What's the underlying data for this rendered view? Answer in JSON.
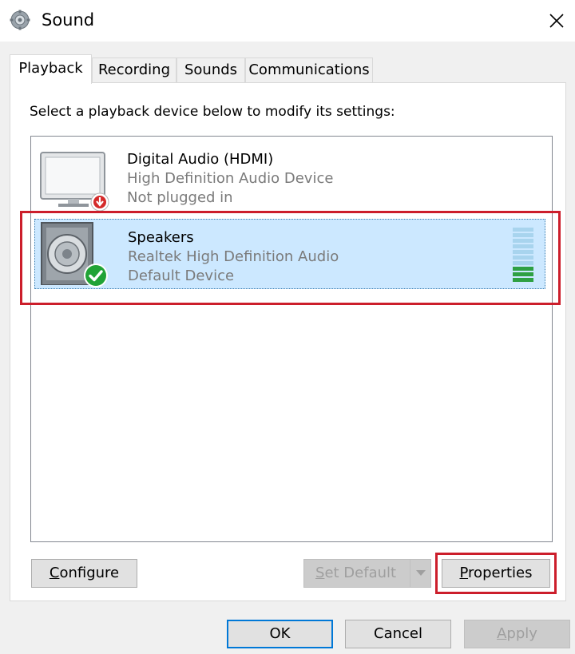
{
  "window": {
    "title": "Sound",
    "icon": "speaker-cog-icon",
    "close_icon": "close-icon"
  },
  "tabs": [
    {
      "label": "Playback",
      "active": true
    },
    {
      "label": "Recording",
      "active": false
    },
    {
      "label": "Sounds",
      "active": false
    },
    {
      "label": "Communications",
      "active": false
    }
  ],
  "playback": {
    "instruction": "Select a playback device below to modify its settings:",
    "devices": [
      {
        "name": "Digital Audio (HDMI)",
        "description": "High Definition Audio Device",
        "status": "Not plugged in",
        "icon": "monitor-icon",
        "badge_icon": "unplugged-badge-icon",
        "selected": false
      },
      {
        "name": "Speakers",
        "description": "Realtek High Definition Audio",
        "status": "Default Device",
        "icon": "speaker-icon",
        "badge_icon": "default-check-icon",
        "selected": true,
        "level_meter": {
          "segments": 10,
          "active_segments": 3,
          "active_color": "#2ea043",
          "idle_color": "#a8d4ee"
        }
      }
    ]
  },
  "buttons": {
    "configure": {
      "pre": "",
      "ul": "C",
      "post": "onfigure"
    },
    "set_default": {
      "pre": "",
      "ul": "S",
      "post": "et Default",
      "enabled": false
    },
    "properties": {
      "pre": "",
      "ul": "P",
      "post": "roperties"
    },
    "ok": "OK",
    "cancel": "Cancel",
    "apply": {
      "pre": "",
      "ul": "A",
      "post": "pply",
      "enabled": false
    }
  },
  "colors": {
    "selection": "#cce8ff",
    "highlight": "#cc1e2b",
    "default_button": "#0078d7"
  }
}
